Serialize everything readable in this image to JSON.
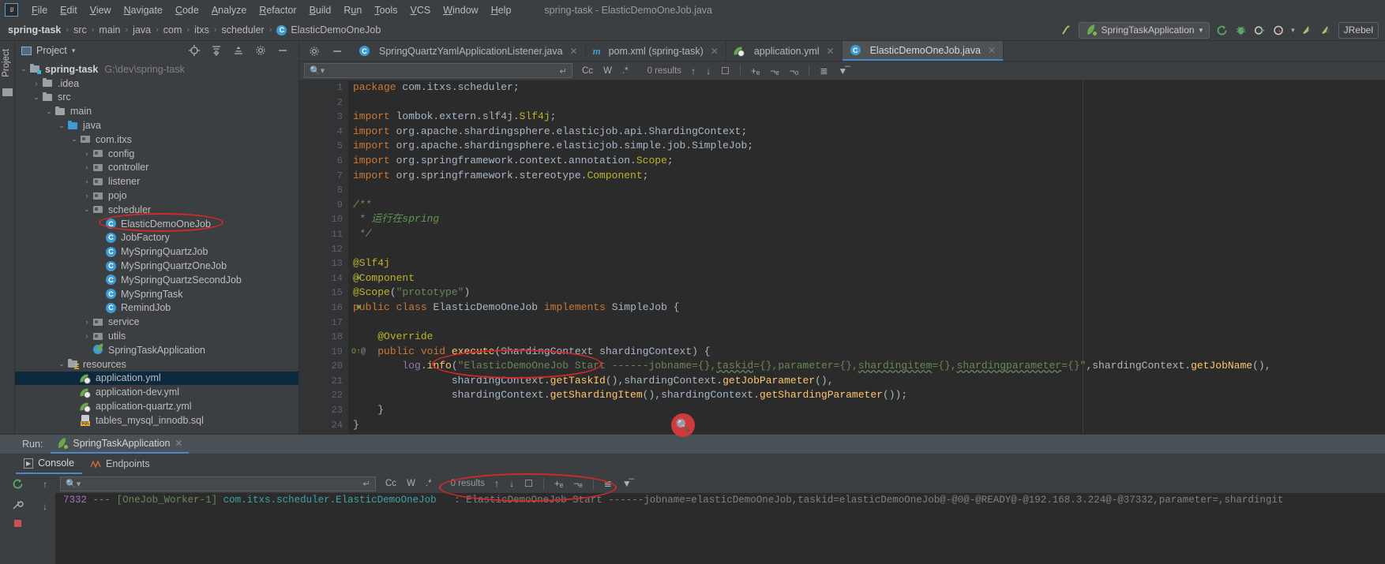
{
  "window": {
    "title": "spring-task - ElasticDemoOneJob.java"
  },
  "menu": {
    "logo": "IJ",
    "items": [
      {
        "label": "File",
        "mn": "F"
      },
      {
        "label": "Edit",
        "mn": "E"
      },
      {
        "label": "View",
        "mn": "V"
      },
      {
        "label": "Navigate",
        "mn": "N"
      },
      {
        "label": "Code",
        "mn": "C"
      },
      {
        "label": "Analyze",
        "mn": "A"
      },
      {
        "label": "Refactor",
        "mn": "R"
      },
      {
        "label": "Build",
        "mn": "B"
      },
      {
        "label": "Run",
        "mn": "u"
      },
      {
        "label": "Tools",
        "mn": "T"
      },
      {
        "label": "VCS",
        "mn": "V"
      },
      {
        "label": "Window",
        "mn": "W"
      },
      {
        "label": "Help",
        "mn": "H"
      }
    ]
  },
  "navbar": {
    "crumbs": [
      "spring-task",
      "src",
      "main",
      "java",
      "com",
      "itxs",
      "scheduler"
    ],
    "class_crumb": "ElasticDemoOneJob",
    "class_icon": "C",
    "run_config": "SpringTaskApplication",
    "run_config_caret": "▾",
    "jrebel_label": "JRebel",
    "icons": [
      "hammer-build-icon",
      "run-icon",
      "debug-icon",
      "run-coverage-icon",
      "profiler-icon",
      "jrebel-run-icon",
      "jrebel-debug-icon"
    ]
  },
  "sidebar": {
    "vertical_tab": "Project",
    "panel_title": "Project",
    "panel_caret": "▾",
    "tools": [
      "locate-icon",
      "expand-all-icon",
      "collapse-all-icon",
      "settings-icon",
      "hide-icon"
    ],
    "tree": [
      {
        "depth": 0,
        "arrow": "⌄",
        "icon": "module-folder",
        "label": "spring-task",
        "bold": true,
        "path": "G:\\dev\\spring-task"
      },
      {
        "depth": 1,
        "arrow": "›",
        "icon": "folder",
        "label": ".idea"
      },
      {
        "depth": 1,
        "arrow": "⌄",
        "icon": "folder",
        "label": "src"
      },
      {
        "depth": 2,
        "arrow": "⌄",
        "icon": "folder",
        "label": "main"
      },
      {
        "depth": 3,
        "arrow": "⌄",
        "icon": "source-folder",
        "label": "java"
      },
      {
        "depth": 4,
        "arrow": "⌄",
        "icon": "package",
        "label": "com.itxs"
      },
      {
        "depth": 5,
        "arrow": "›",
        "icon": "package",
        "label": "config"
      },
      {
        "depth": 5,
        "arrow": "›",
        "icon": "package",
        "label": "controller"
      },
      {
        "depth": 5,
        "arrow": "›",
        "icon": "package",
        "label": "listener"
      },
      {
        "depth": 5,
        "arrow": "›",
        "icon": "package",
        "label": "pojo"
      },
      {
        "depth": 5,
        "arrow": "⌄",
        "icon": "package",
        "label": "scheduler"
      },
      {
        "depth": 6,
        "arrow": "",
        "icon": "class",
        "label": "ElasticDemoOneJob",
        "circled": true
      },
      {
        "depth": 6,
        "arrow": "",
        "icon": "class",
        "label": "JobFactory"
      },
      {
        "depth": 6,
        "arrow": "",
        "icon": "class",
        "label": "MySpringQuartzJob"
      },
      {
        "depth": 6,
        "arrow": "",
        "icon": "class",
        "label": "MySpringQuartzOneJob"
      },
      {
        "depth": 6,
        "arrow": "",
        "icon": "class",
        "label": "MySpringQuartzSecondJob"
      },
      {
        "depth": 6,
        "arrow": "",
        "icon": "class",
        "label": "MySpringTask"
      },
      {
        "depth": 6,
        "arrow": "",
        "icon": "class",
        "label": "RemindJob"
      },
      {
        "depth": 5,
        "arrow": "›",
        "icon": "package",
        "label": "service"
      },
      {
        "depth": 5,
        "arrow": "›",
        "icon": "package",
        "label": "utils"
      },
      {
        "depth": 5,
        "arrow": "",
        "icon": "spring-class",
        "label": "SpringTaskApplication"
      },
      {
        "depth": 3,
        "arrow": "⌄",
        "icon": "resource-folder",
        "label": "resources"
      },
      {
        "depth": 4,
        "arrow": "",
        "icon": "yaml",
        "label": "application.yml",
        "selected": true
      },
      {
        "depth": 4,
        "arrow": "",
        "icon": "yaml",
        "label": "application-dev.yml"
      },
      {
        "depth": 4,
        "arrow": "",
        "icon": "yaml",
        "label": "application-quartz.yml"
      },
      {
        "depth": 4,
        "arrow": "",
        "icon": "sql",
        "label": "tables_mysql_innodb.sql"
      }
    ]
  },
  "editor": {
    "tabs": [
      {
        "label": "SpringQuartzYamlApplicationListener.java",
        "icon": "class",
        "active": false
      },
      {
        "label": "pom.xml (spring-task)",
        "icon": "maven",
        "active": false
      },
      {
        "label": "application.yml",
        "icon": "yaml",
        "active": false
      },
      {
        "label": "ElasticDemoOneJob.java",
        "icon": "class",
        "active": true
      }
    ],
    "findbar": {
      "placeholder": "",
      "value": "",
      "results": "0 results",
      "opts": [
        "Cc",
        "W",
        ".*"
      ],
      "icons": [
        "search-icon",
        "regex-history-icon",
        "prev-match-icon",
        "next-match-icon",
        "select-all-icon",
        "add-icon",
        "exclude-icon",
        "filter-icon",
        "view-options-icon"
      ]
    },
    "lines": [
      {
        "n": 1,
        "html": "<span class='kw'>package</span> com.itxs.scheduler;"
      },
      {
        "n": 2,
        "html": ""
      },
      {
        "n": 3,
        "fold": "⊖",
        "html": "<span class='kw'>import</span> lombok.extern.slf4j.<span class='ann'>Slf4j</span>;"
      },
      {
        "n": 4,
        "html": "<span class='kw'>import</span> org.apache.shardingsphere.elasticjob.api.<span class='typ'>ShardingContext</span>;"
      },
      {
        "n": 5,
        "html": "<span class='kw'>import</span> org.apache.shardingsphere.elasticjob.simple.job.<span class='typ'>SimpleJob</span>;"
      },
      {
        "n": 6,
        "html": "<span class='kw'>import</span> org.springframework.context.annotation.<span class='ann'>Scope</span>;"
      },
      {
        "n": 7,
        "fold": "⊖",
        "html": "<span class='kw'>import</span> org.springframework.stereotype.<span class='ann'>Component</span>;"
      },
      {
        "n": 8,
        "html": ""
      },
      {
        "n": 9,
        "fold": "⊖",
        "html": "<span class='cmt'>/**</span>"
      },
      {
        "n": 10,
        "html": " <span class='cmt'>* 运行在spring</span>"
      },
      {
        "n": 11,
        "fold": "⊖",
        "html": " <span class='cmt'>*/</span>"
      },
      {
        "n": 12,
        "html": ""
      },
      {
        "n": 13,
        "fold": "⊖",
        "html": "<span class='ann'>@Slf4j</span>"
      },
      {
        "n": 14,
        "mark": "bean",
        "html": "<span class='ann'>@Component</span>"
      },
      {
        "n": 15,
        "fold": "⊖",
        "html": "<span class='ann'>@Scope</span>(<span class='str'>\"prototype\"</span>)"
      },
      {
        "n": 16,
        "mark": "springbean",
        "html": "<span class='kw'>public class</span> <span class='typ'>ElasticDemoOneJob</span> <span class='kw'>implements</span> <span class='typ'>SimpleJob</span> {"
      },
      {
        "n": 17,
        "html": ""
      },
      {
        "n": 18,
        "html": "    <span class='ann'>@Override</span>"
      },
      {
        "n": 19,
        "mark": "override",
        "fold": "⊖",
        "html": "    <span class='kw'>public void</span> <span class='mth'>execute</span>(<span class='typ'>ShardingContext</span> shardingContext) {"
      },
      {
        "n": 20,
        "html": "        <span class='fld'>log</span>.<span class='mth'>info</span>(<span class='str'>\"ElasticDemoOneJob Start ------jobname={},<span class='err'>taskid</span>={},parameter={},<span class='err'>shardingitem</span>={},<span class='err'>shardingparameter</span>={}\"</span>,shardingContext.<span class='mth'>getJobName</span>(),"
      },
      {
        "n": 21,
        "html": "                shardingContext.<span class='mth'>getTaskId</span>(),shardingContext.<span class='mth'>getJobParameter</span>(),"
      },
      {
        "n": 22,
        "html": "                shardingContext.<span class='mth'>getShardingItem</span>(),shardingContext.<span class='mth'>getShardingParameter</span>());"
      },
      {
        "n": 23,
        "fold": "⊖",
        "html": "    }"
      },
      {
        "n": 24,
        "html": "}"
      }
    ]
  },
  "run_panel": {
    "run_label": "Run:",
    "tab_label": "SpringTaskApplication",
    "sub_tabs": [
      {
        "label": "Console",
        "icon": "console-icon",
        "active": true
      },
      {
        "label": "Endpoints",
        "icon": "endpoints-icon",
        "active": false
      }
    ],
    "findbar": {
      "results": "0 results",
      "opts": [
        "Cc",
        "W",
        ".*"
      ]
    },
    "console_line": {
      "pid": "7332",
      "dashes": "---",
      "thread": "[OneJob_Worker-1]",
      "logger": "com.itxs.scheduler.ElasticDemoOneJob",
      "message": ": ElasticDemoOneJob Start ------jobname=elasticDemoOneJob,taskid=elasticDemoOneJob@-@0@-@READY@-@192.168.3.224@-@37332,parameter=,shardingit"
    },
    "side_icons": [
      "rerun-icon",
      "settings-wrench-icon",
      "stop-icon"
    ],
    "gutter_icons": [
      "scroll-up-icon",
      "scroll-down-icon"
    ]
  },
  "annotations": {
    "ellipse_color": "#d02a2a",
    "magnifier_color": "#cc3a3a",
    "magnifier_icon": "search-icon"
  }
}
